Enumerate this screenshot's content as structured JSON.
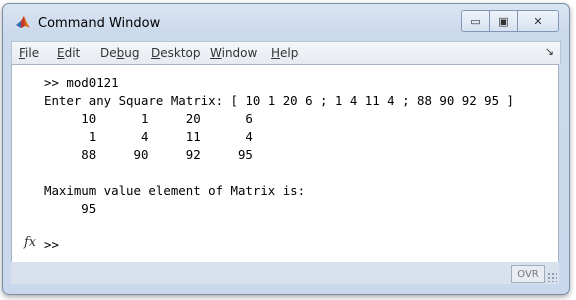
{
  "window": {
    "title": "Command Window",
    "controls": {
      "minimize": "▭",
      "restore": "▣",
      "close": "✕"
    }
  },
  "menu": {
    "items": [
      {
        "mnemonic": "F",
        "rest": "ile"
      },
      {
        "mnemonic": "E",
        "rest": "dit"
      },
      {
        "pre": "De",
        "mnemonic": "b",
        "rest": "ug"
      },
      {
        "mnemonic": "D",
        "rest": "esktop"
      },
      {
        "mnemonic": "W",
        "rest": "indow"
      },
      {
        "mnemonic": "H",
        "rest": "elp"
      }
    ],
    "dock_arrow": "↘"
  },
  "console": {
    "lines": [
      ">> mod0121",
      "Enter any Square Matrix: [ 10 1 20 6 ; 1 4 11 4 ; 88 90 92 95 ]",
      "     10      1     20      6",
      "      1      4     11      4",
      "     88     90     92     95",
      "",
      "Maximum value element of Matrix is:",
      "     95",
      "",
      ">>"
    ],
    "fx_label": "fx"
  },
  "status": {
    "ovr": "OVR"
  }
}
